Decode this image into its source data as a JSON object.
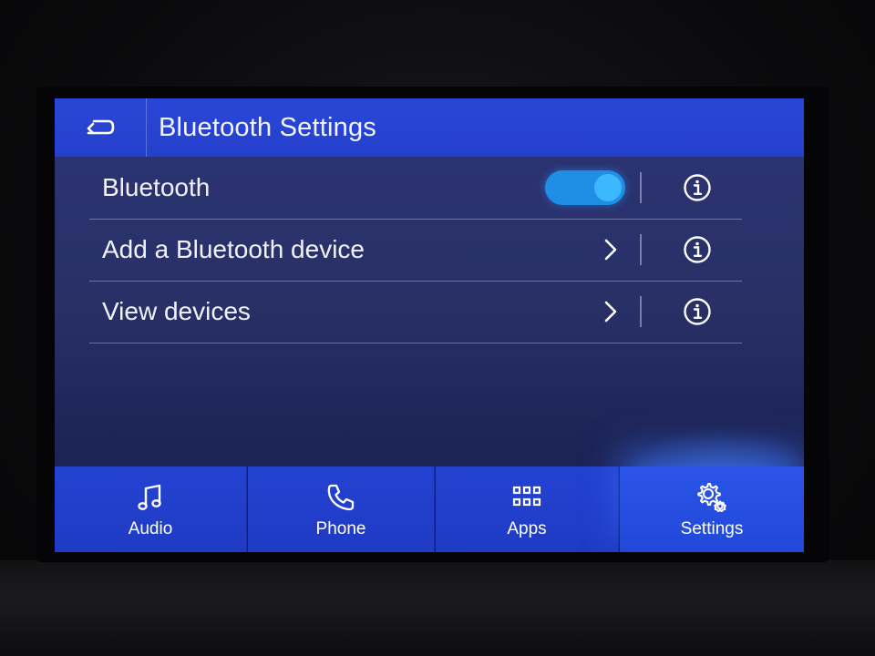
{
  "header": {
    "title": "Bluetooth Settings",
    "back_icon": "back-arrow-icon"
  },
  "rows": [
    {
      "label": "Bluetooth",
      "control": "toggle",
      "toggle_on": true,
      "info_icon": "info-icon"
    },
    {
      "label": "Add a Bluetooth device",
      "control": "chevron",
      "info_icon": "info-icon"
    },
    {
      "label": "View devices",
      "control": "chevron",
      "info_icon": "info-icon"
    }
  ],
  "tabs": [
    {
      "label": "Audio",
      "icon": "music-note-icon",
      "active": false
    },
    {
      "label": "Phone",
      "icon": "phone-icon",
      "active": false
    },
    {
      "label": "Apps",
      "icon": "apps-grid-icon",
      "active": false
    },
    {
      "label": "Settings",
      "icon": "gears-icon",
      "active": true
    }
  ],
  "colors": {
    "title_bar": "#2a46d8",
    "screen_bg": "#283066",
    "toggle_on": "#1f8fe6",
    "tab_bg": "#2442d2"
  }
}
